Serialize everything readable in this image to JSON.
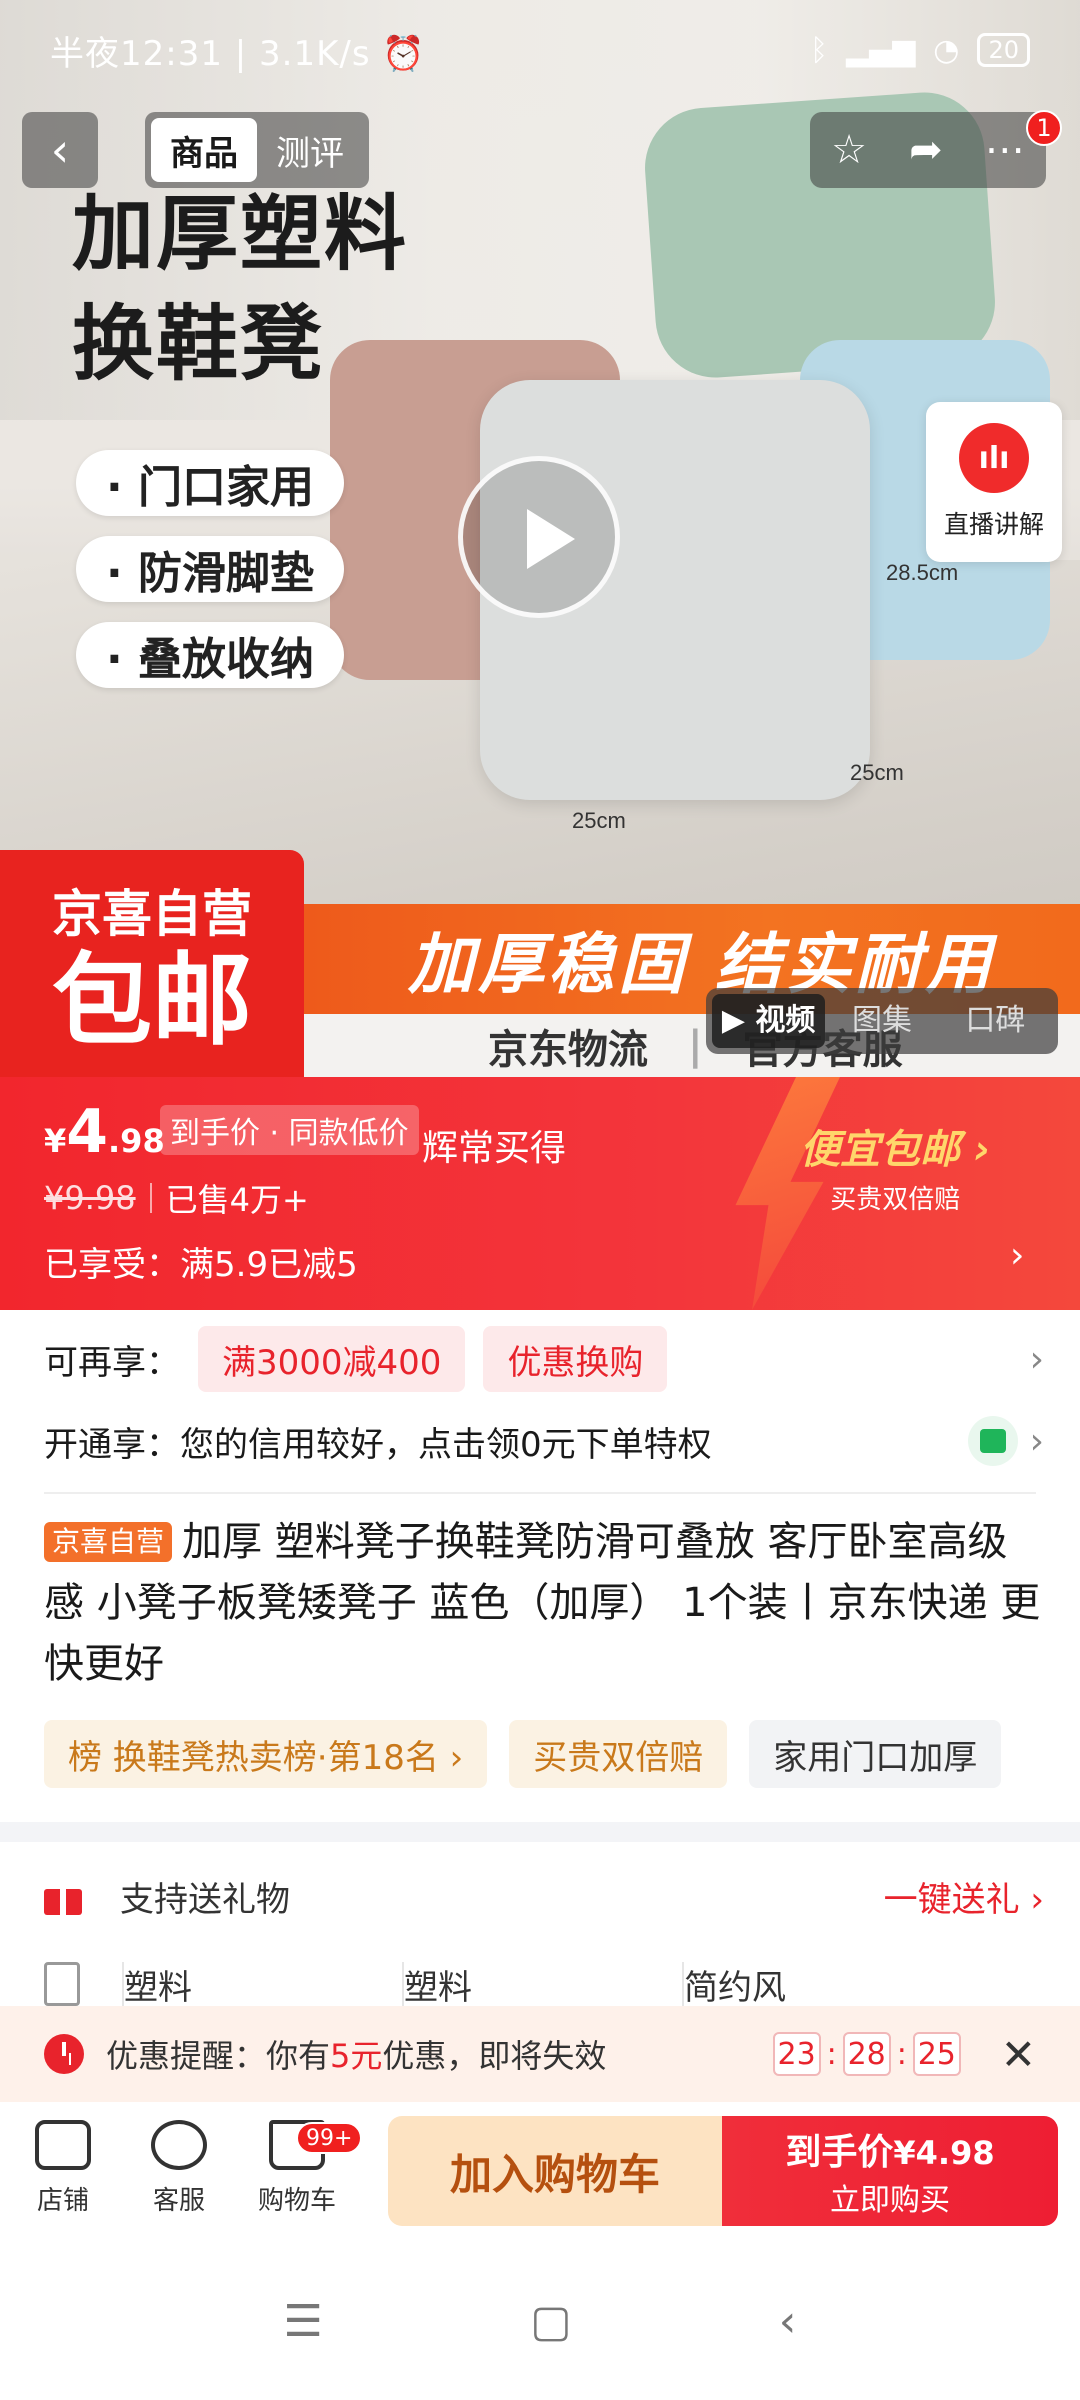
{
  "status_bar": {
    "left_text": "半夜12:31 | 3.1K/s",
    "battery": "20"
  },
  "header": {
    "back_label": "‹",
    "tabs": [
      "商品",
      "测评"
    ],
    "notification_count": "1"
  },
  "hero": {
    "title_lines": [
      "加厚塑料",
      "换鞋凳"
    ],
    "bullets": [
      "· 门口家用",
      "· 防滑脚垫",
      "· 叠放收纳"
    ],
    "dimensions": [
      "28.5cm",
      "25cm",
      "25cm"
    ],
    "live_label": "直播讲解",
    "badge_line1": "京喜自营",
    "badge_line2": "包邮",
    "slogan": "加厚稳固 结实耐用",
    "services": [
      "京东物流",
      "官方客服"
    ],
    "media_tabs": [
      "视频",
      "图集",
      "口碑"
    ]
  },
  "price": {
    "yen": "¥",
    "integer": "4",
    "decimal": ".98",
    "tag": "到手价 · 同款低价",
    "note": "辉常买得",
    "original": "¥9.98",
    "sold": "已售4万+",
    "enjoyed": "已享受：满5.9已减5",
    "promo_title": "便宜包邮 ›",
    "promo_sub": "买贵双倍赔"
  },
  "offers": {
    "more_label": "可再享：",
    "chips": [
      "满3000减400",
      "优惠换购"
    ],
    "credit_text": "开通享：您的信用较好，点击领0元下单特权"
  },
  "product": {
    "self_tag": "京喜自营",
    "title": "加厚 塑料凳子换鞋凳防滑可叠放 客厅卧室高级感 小凳子板凳矮凳子 蓝色（加厚） 1个装丨京东快递 更快更好",
    "tags": [
      "榜 换鞋凳热卖榜·第18名 ›",
      "买贵双倍赔",
      "家用门口加厚"
    ]
  },
  "gift": {
    "label": "支持送礼物",
    "action": "一键送礼 ›"
  },
  "attributes": [
    "塑料",
    "塑料",
    "简约风"
  ],
  "reminder": {
    "prefix": "优惠提醒：你有",
    "amount": "5元",
    "suffix": "优惠，即将失效",
    "hours": "23",
    "minutes": "28",
    "seconds": "25"
  },
  "bottom_bar": {
    "shop": "店铺",
    "service": "客服",
    "cart": "购物车",
    "cart_badge": "99+",
    "add_cart": "加入购物车",
    "buy_line1": "到手价",
    "buy_price": "¥4.98",
    "buy_line2": "立即购买"
  },
  "colors": {
    "brand_red": "#f2262d",
    "orange": "#f3702a",
    "accent_gold": "#ffd66b"
  }
}
